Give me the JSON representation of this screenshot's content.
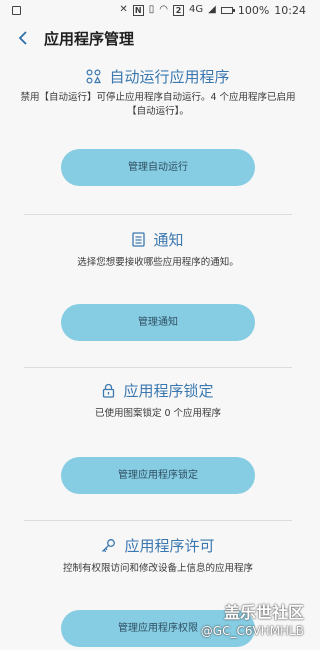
{
  "status_bar": {
    "battery": "100%",
    "time": "10:24",
    "network": "4G"
  },
  "header": {
    "title": "应用程序管理"
  },
  "sections": [
    {
      "title": "自动运行应用程序",
      "icon": "apps-grid-icon",
      "description": "禁用【自动运行】可停止应用程序自动运行。4 个应用程序已启用【自动运行】。",
      "button": "管理自动运行"
    },
    {
      "title": "通知",
      "icon": "notification-icon",
      "description": "选择您想要接收哪些应用程序的通知。",
      "button": "管理通知"
    },
    {
      "title": "应用程序锁定",
      "icon": "lock-icon",
      "description": "已使用图案锁定 0 个应用程序",
      "button": "管理应用程序锁定"
    },
    {
      "title": "应用程序许可",
      "icon": "key-icon",
      "description": "控制有权限访问和修改设备上信息的应用程序",
      "button": "管理应用程序权限"
    }
  ],
  "watermark": {
    "line1": "盖乐世社区",
    "line2": "@GC_C6VHMHLB"
  },
  "colors": {
    "accent": "#3b78b0",
    "button_bg": "#86cde3",
    "background": "#f7f7f7"
  }
}
